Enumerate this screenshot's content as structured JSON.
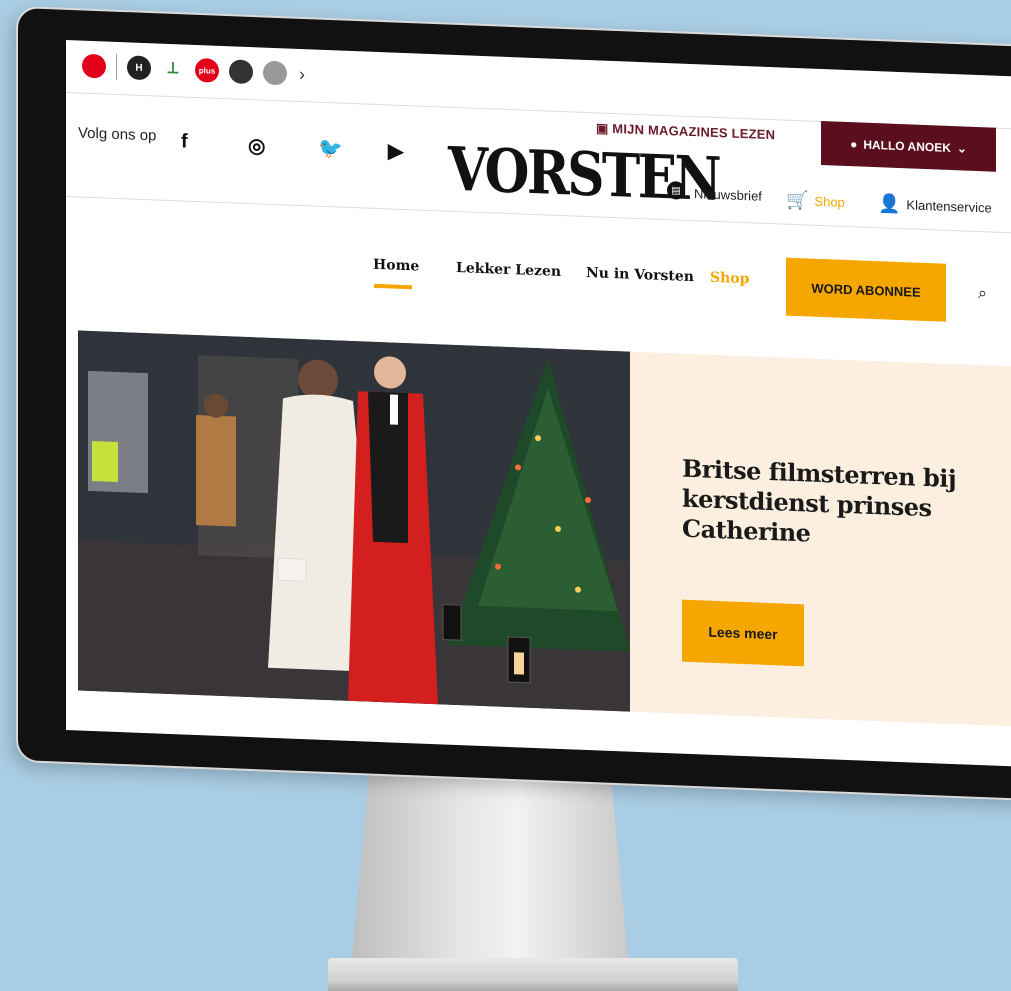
{
  "brands": {
    "items": [
      {
        "name": "brand-logo-red",
        "glyph": ""
      },
      {
        "name": "brand-logo-h",
        "glyph": "H"
      },
      {
        "name": "brand-logo-green",
        "glyph": "⟂"
      },
      {
        "name": "brand-logo-plus",
        "glyph": "plus"
      },
      {
        "name": "brand-logo-dark",
        "glyph": ""
      },
      {
        "name": "brand-logo-grey",
        "glyph": ""
      }
    ],
    "next_icon": "›"
  },
  "header": {
    "magazines_label": "MIJN MAGAZINES LEZEN",
    "account_label": "HALLO ANOEK",
    "account_chevron": "⌄",
    "follow_label": "Volg ons op",
    "social": {
      "facebook": "f",
      "instagram": "◎",
      "twitter": "🐦",
      "youtube": "▶"
    },
    "logo_text": "VORSTEN",
    "newsletter_label": "Nieuwsbrief",
    "shop_label": "Shop",
    "service_label": "Klantenservice"
  },
  "nav": {
    "items": [
      "Home",
      "Lekker Lezen",
      "Nu in Vorsten",
      "Shop"
    ],
    "active": "Home",
    "subscribe_label": "WORD ABONNEE",
    "search_icon": "⌕"
  },
  "hero": {
    "headline": "Britse filmsterren bij kerstdienst prinses Catherine",
    "cta_label": "Lees meer"
  },
  "colors": {
    "accent": "#f5a700",
    "account_bg": "#5b0f1e",
    "panel_bg": "#fcefdf",
    "backdrop": "#a9cde4"
  }
}
